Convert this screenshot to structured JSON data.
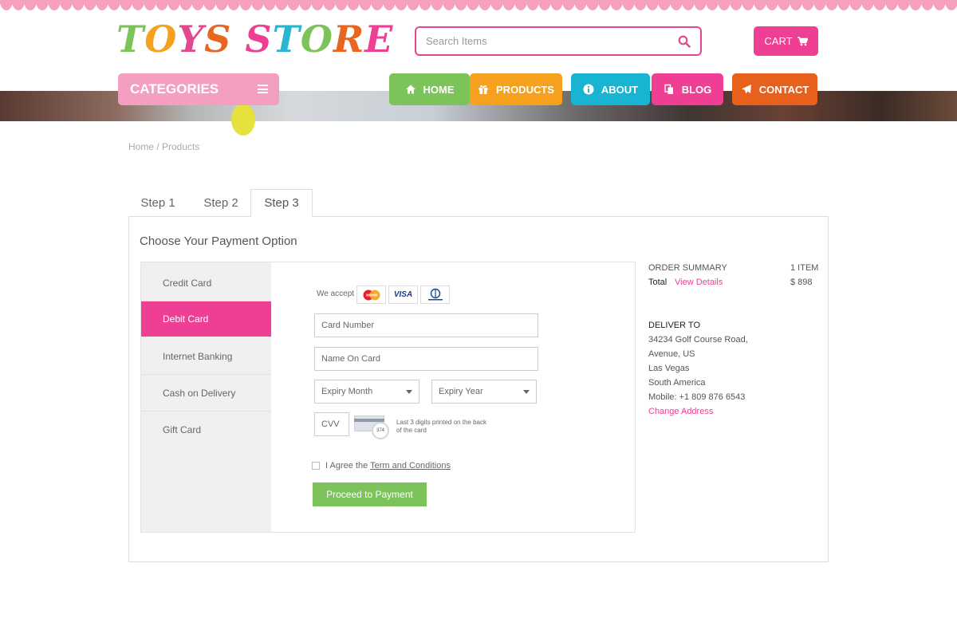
{
  "brand": {
    "logo_letters": [
      "T",
      "O",
      "Y",
      "S",
      " ",
      "S",
      "T",
      "O",
      "R",
      "E"
    ],
    "logo_colors": [
      "#7cc35a",
      "#f4a11d",
      "#e3488e",
      "#e8661f",
      "#ffffff",
      "#ef3f94",
      "#29b4d1",
      "#7cc35a",
      "#e8661f",
      "#ef3f94"
    ]
  },
  "search": {
    "placeholder": "Search Items"
  },
  "cart": {
    "label": "CART"
  },
  "categories": {
    "label": "CATEGORIES"
  },
  "nav": [
    {
      "label": "HOME",
      "icon": "home-icon",
      "color": "#7cc35a"
    },
    {
      "label": "PRODUCTS",
      "icon": "gift-icon",
      "color": "#f5a11e"
    },
    {
      "label": "ABOUT",
      "icon": "info-icon",
      "color": "#18b4d1"
    },
    {
      "label": "BLOG",
      "icon": "copy-icon",
      "color": "#ef3f94"
    },
    {
      "label": "CONTACT",
      "icon": "send-icon",
      "color": "#e8611c"
    }
  ],
  "breadcrumb": "Home / Products",
  "tabs": [
    "Step 1",
    "Step 2",
    "Step 3"
  ],
  "panel": {
    "title": "Choose Your Payment Option"
  },
  "payment_methods": [
    "Credit Card",
    "Debit Card",
    "Internet Banking",
    "Cash on Delivery",
    "Gift Card"
  ],
  "form": {
    "we_accept": "We accept",
    "card_number_placeholder": "Card Number",
    "name_on_card_placeholder": "Name On Card",
    "expiry_month": "Expiry Month",
    "expiry_year": "Expiry Year",
    "cvv_placeholder": "CVV",
    "cvv_sample": "374",
    "cvv_hint": "Last 3 digits printed on the back of the card",
    "agree_prefix": "I Agree the",
    "agree_link": "Term and Conditions",
    "proceed": "Proceed to Payment",
    "visa_text": "VISA"
  },
  "summary": {
    "heading": "ORDER SUMMARY",
    "items": "1 ITEM",
    "total_label": "Total",
    "view_details": "View Details",
    "total_value": "$ 898",
    "deliver_heading": "DELIVER TO",
    "address": [
      "34234 Golf Course Road,",
      "Avenue, US",
      "Las Vegas",
      "South America",
      "Mobile: +1 809 876 6543"
    ],
    "change_address": "Change Address"
  },
  "colors": {
    "accent_pink": "#ef3f94",
    "proceed_green": "#7cc35a",
    "search_border": "#e3488e"
  }
}
